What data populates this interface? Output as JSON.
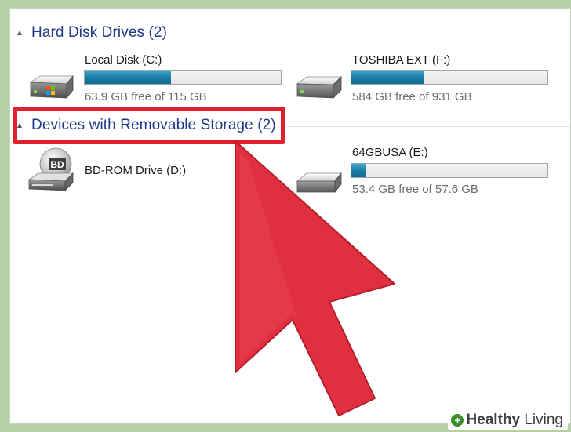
{
  "sections": {
    "hard_disk": {
      "title": "Hard Disk Drives (2)"
    },
    "removable": {
      "title": "Devices with Removable Storage (2)"
    }
  },
  "drives": {
    "c": {
      "name": "Local Disk (C:)",
      "free_text": "63.9 GB free of 115 GB",
      "used_fraction": 0.44
    },
    "f": {
      "name": "TOSHIBA EXT (F:)",
      "free_text": "584 GB free of 931 GB",
      "used_fraction": 0.37
    },
    "d": {
      "name": "BD-ROM Drive (D:)",
      "icon_label": "BD"
    },
    "e": {
      "name": "64GBUSA (E:)",
      "free_text": "53.4 GB free of 57.6 GB",
      "used_fraction": 0.07
    }
  },
  "colors": {
    "highlight_box": "#e0202c",
    "arrow": "#e02f3f",
    "section_title": "#1e3a8a",
    "usage_bar": "#1c7ea6"
  },
  "watermark": {
    "prefix": "Healthy",
    "suffix": " Living"
  }
}
